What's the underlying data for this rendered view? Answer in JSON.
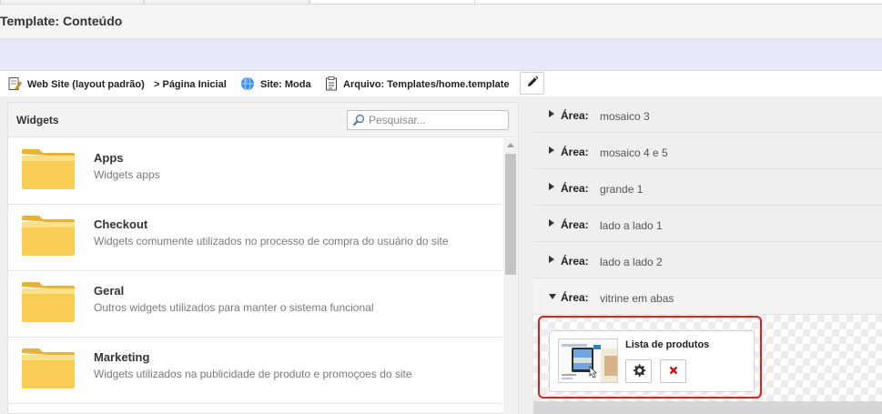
{
  "page": {
    "title": "Template: Conteúdo"
  },
  "breadcrumb": {
    "website": "Web Site (layout padrão)",
    "page": "> Página Inicial",
    "site": "Site: Moda",
    "file": "Arquivo: Templates/home.template"
  },
  "widgets": {
    "title": "Widgets",
    "search_placeholder": "Pesquisar...",
    "items": [
      {
        "name": "Apps",
        "description": "Widgets apps"
      },
      {
        "name": "Checkout",
        "description": "Widgets comumente utilizados no processo de compra do usuário do site"
      },
      {
        "name": "Geral",
        "description": "Outros widgets utilizados para manter o sistema funcional"
      },
      {
        "name": "Marketing",
        "description": "Widgets utilizados na publicidade de produto e promoçoes do site"
      }
    ]
  },
  "areas": {
    "label": "Área:",
    "items": [
      {
        "value": "mosaico 3",
        "expanded": false
      },
      {
        "value": "mosaico 4 e 5",
        "expanded": false
      },
      {
        "value": "grande 1",
        "expanded": false
      },
      {
        "value": "lado a lado 1",
        "expanded": false
      },
      {
        "value": "lado a lado 2",
        "expanded": false
      },
      {
        "value": "vitrine em abas",
        "expanded": true
      }
    ]
  },
  "placed_widget": {
    "title": "Lista de produtos",
    "settings_icon": "gear-icon",
    "remove_icon": "close-icon"
  },
  "colors": {
    "highlight": "#e02020",
    "remove": "#cc1111",
    "folder": "#f5c842",
    "info_band": "#e6e9f8"
  }
}
